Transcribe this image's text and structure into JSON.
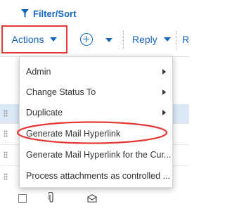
{
  "filter": {
    "label": "Filter/Sort"
  },
  "toolbar": {
    "actions_label": "Actions",
    "reply_label": "Reply",
    "next_label_fragment": "R"
  },
  "menu": {
    "items": [
      {
        "label": "Admin",
        "has_submenu": true
      },
      {
        "label": "Change Status To",
        "has_submenu": true
      },
      {
        "label": "Duplicate",
        "has_submenu": true
      },
      {
        "label": "Generate Mail Hyperlink",
        "has_submenu": false,
        "highlighted": true
      },
      {
        "label": "Generate Mail Hyperlink for the Cur...",
        "has_submenu": false
      },
      {
        "label": "Process attachments as controlled ...",
        "has_submenu": false
      }
    ]
  },
  "colors": {
    "accent": "#1565c0",
    "highlight": "#e53935",
    "selected_row": "#dbe8f6"
  },
  "icons": [
    "filter-icon",
    "plus-circle-icon",
    "chevron-down-icon",
    "chevron-right-icon",
    "drag-handle-icon",
    "paperclip-icon",
    "envelope-icon"
  ]
}
